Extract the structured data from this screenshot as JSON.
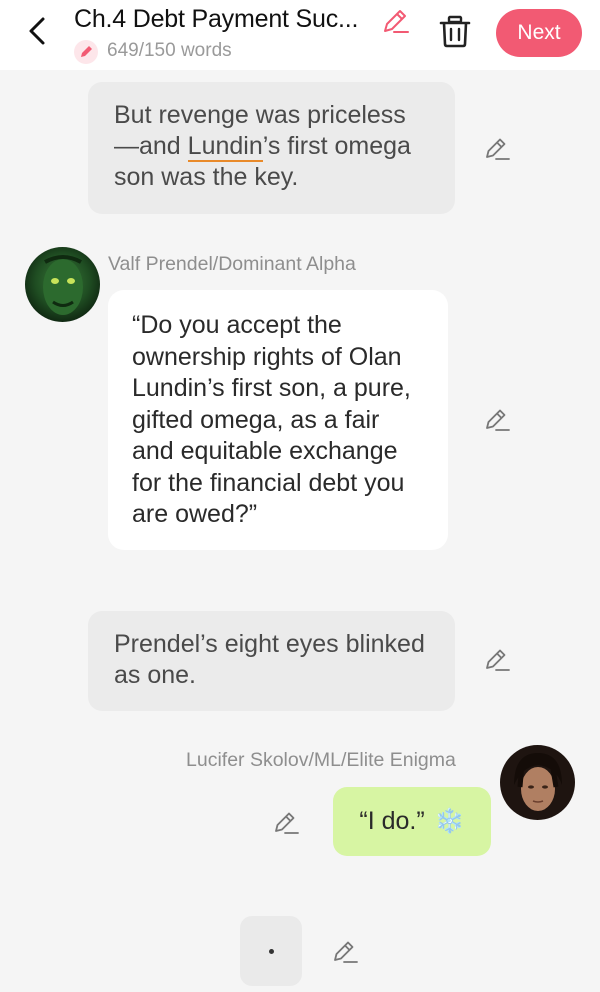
{
  "header": {
    "title": "Ch.4 Debt Payment Suc...",
    "word_count": "649/150 words",
    "next_label": "Next"
  },
  "messages": [
    {
      "type": "narration",
      "text_before": "But revenge was priceless —and ",
      "underlined": "Lundin",
      "text_after": "’s first omega son was the key."
    },
    {
      "type": "character",
      "speaker": "Valf Prendel/Dominant Alpha",
      "text": "“Do you accept the ownership rights of Olan Lundin’s first son, a pure, gifted omega, as a fair and equitable exchange for the financial debt you are owed?”"
    },
    {
      "type": "narration",
      "text": "Prendel’s eight eyes blinked as one."
    },
    {
      "type": "protagonist",
      "speaker": "Lucifer Skolov/ML/Elite Enigma",
      "text": "“I do.”",
      "emoji": "❄️"
    },
    {
      "type": "typing",
      "text": "·"
    }
  ],
  "colors": {
    "accent": "#f25a73",
    "narration_bg": "#ebebeb",
    "protagonist_bg": "#d7f5a3",
    "underline": "#e98a2a"
  }
}
